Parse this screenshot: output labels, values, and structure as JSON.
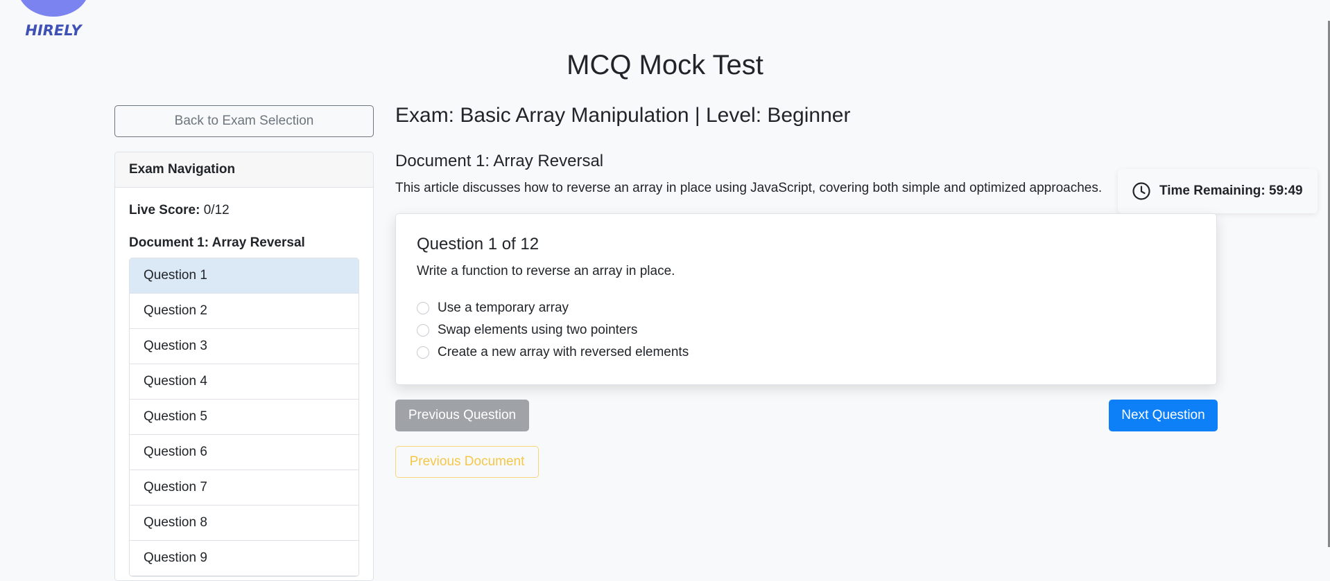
{
  "brand": {
    "name": "HIRELY"
  },
  "page": {
    "title": "MCQ Mock Test"
  },
  "sidebar": {
    "back_label": "Back to Exam Selection",
    "nav_title": "Exam Navigation",
    "live_score_label": "Live Score:",
    "live_score_value": "0/12",
    "document_label": "Document 1: Array Reversal",
    "questions": [
      "Question 1",
      "Question 2",
      "Question 3",
      "Question 4",
      "Question 5",
      "Question 6",
      "Question 7",
      "Question 8",
      "Question 9"
    ],
    "active_index": 0
  },
  "main": {
    "exam_title": "Exam: Basic Array Manipulation | Level: Beginner",
    "document_title": "Document 1: Array Reversal",
    "document_description": "This article discusses how to reverse an array in place using JavaScript, covering both simple and optimized approaches.",
    "timer": {
      "icon": "clock-icon",
      "text": "Time Remaining: 59:49"
    },
    "question": {
      "heading": "Question 1 of 12",
      "text": "Write a function to reverse an array in place.",
      "options": [
        "Use a temporary array",
        "Swap elements using two pointers",
        "Create a new array with reversed elements"
      ]
    },
    "buttons": {
      "previous_question": "Previous Question",
      "next_question": "Next Question",
      "previous_document": "Previous Document"
    }
  },
  "colors": {
    "primary": "#0d7ff7",
    "secondary": "#9fa3a7",
    "warning": "#f5c749",
    "active_item": "#dbe9f6",
    "logo": "#7b83f0"
  }
}
